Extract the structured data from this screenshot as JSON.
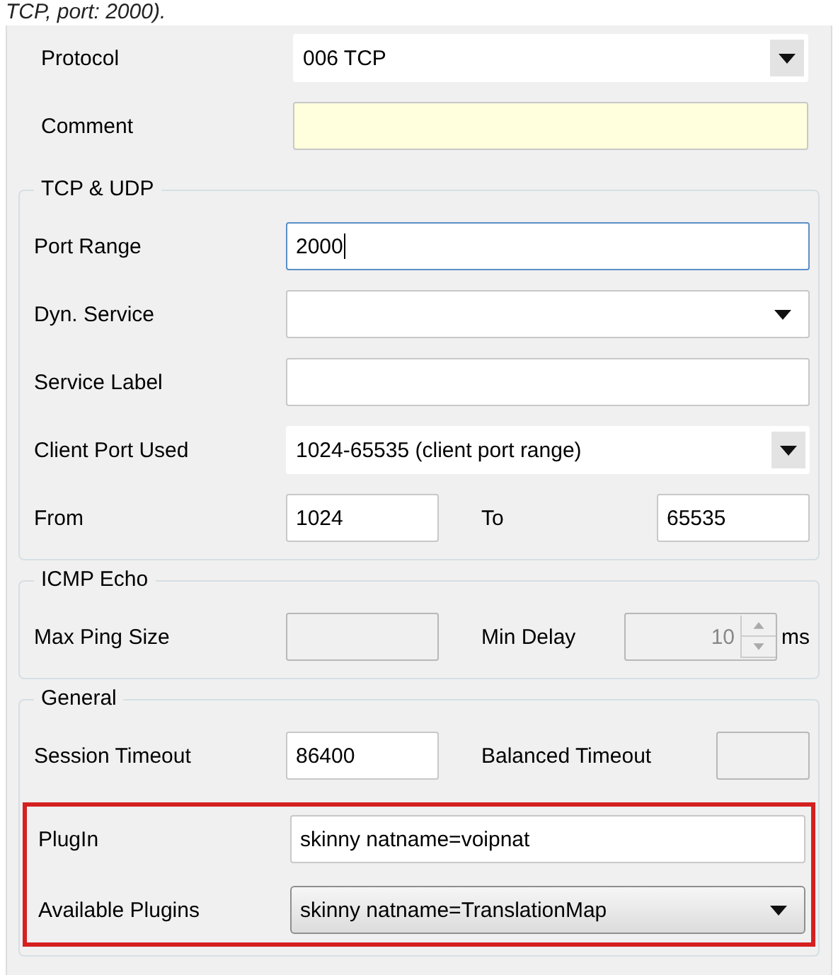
{
  "caption": "TCP, port: 2000).",
  "sections": [
    {
      "rows": [
        [
          {
            "label": "Protocol",
            "kind": "flat-combo",
            "value": "006 TCP"
          }
        ],
        [
          {
            "label": "Comment",
            "kind": "text",
            "highlighted": true
          }
        ]
      ]
    },
    {
      "legend": "TCP & UDP",
      "rows": [
        [
          {
            "label": "Port Range",
            "kind": "text",
            "value": "2000",
            "focused": true
          }
        ],
        [
          {
            "label": "Dyn. Service",
            "kind": "combo"
          }
        ],
        [
          {
            "label": "Service Label",
            "kind": "text"
          }
        ],
        [
          {
            "label": "Client Port Used",
            "kind": "flat-combo",
            "value": "1024-65535 (client port range)"
          }
        ],
        [
          {
            "label": "From",
            "kind": "text",
            "value": "1024"
          },
          {
            "label": "To",
            "kind": "text",
            "value": "65535"
          }
        ]
      ]
    },
    {
      "legend": "ICMP Echo",
      "rows": [
        [
          {
            "label": "Max Ping Size",
            "kind": "text",
            "disabled": true
          },
          {
            "label": "Min Delay",
            "kind": "spin",
            "value": "10",
            "unit": "ms",
            "disabled": true
          }
        ]
      ]
    },
    {
      "legend": "General",
      "rows": [
        [
          {
            "label": "Session Timeout",
            "kind": "text",
            "value": "86400"
          },
          {
            "label": "Balanced Timeout",
            "kind": "text",
            "disabled": true
          }
        ]
      ],
      "highlighted_rows": [
        [
          {
            "label": "PlugIn",
            "kind": "text",
            "value": "skinny natname=voipnat"
          }
        ],
        [
          {
            "label": "Available Plugins",
            "kind": "button-combo",
            "value": "skinny natname=TranslationMap"
          }
        ]
      ]
    }
  ]
}
